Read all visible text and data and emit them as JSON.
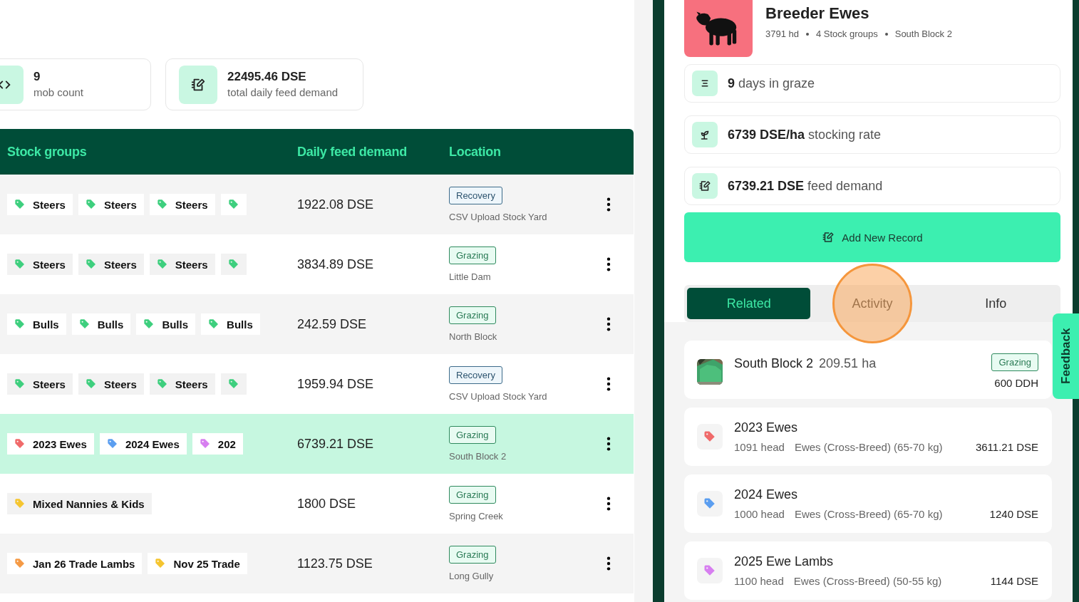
{
  "summary": [
    {
      "kind": "code",
      "value": "9",
      "label": "mob count"
    },
    {
      "kind": "feed",
      "value": "22495.46 DSE",
      "label": "total daily feed demand"
    }
  ],
  "table": {
    "columns": [
      "Stock groups",
      "Daily feed demand",
      "Location"
    ],
    "rows": [
      {
        "selected": false,
        "groups": [
          {
            "label": "Steers",
            "color": "#3ecf7e"
          },
          {
            "label": "Steers",
            "color": "#3ecf7e"
          },
          {
            "label": "Steers",
            "color": "#3ecf7e"
          },
          {
            "color": "#3ecf7e"
          }
        ],
        "demand": "1922.08 DSE",
        "status": {
          "label": "Recovery",
          "kind": "recovery"
        },
        "location": "CSV Upload Stock Yard"
      },
      {
        "selected": false,
        "groups": [
          {
            "label": "Steers",
            "color": "#3ecf7e"
          },
          {
            "label": "Steers",
            "color": "#3ecf7e"
          },
          {
            "label": "Steers",
            "color": "#3ecf7e"
          },
          {
            "color": "#3ecf7e"
          }
        ],
        "demand": "3834.89 DSE",
        "status": {
          "label": "Grazing",
          "kind": "grazing"
        },
        "location": "Little Dam"
      },
      {
        "selected": false,
        "groups": [
          {
            "label": "Bulls",
            "color": "#3ecf7e"
          },
          {
            "label": "Bulls",
            "color": "#3ecf7e"
          },
          {
            "label": "Bulls",
            "color": "#3ecf7e"
          },
          {
            "label": "Bulls",
            "color": "#3ecf7e"
          }
        ],
        "demand": "242.59 DSE",
        "status": {
          "label": "Grazing",
          "kind": "grazing"
        },
        "location": "North Block"
      },
      {
        "selected": false,
        "groups": [
          {
            "label": "Steers",
            "color": "#3ecf7e"
          },
          {
            "label": "Steers",
            "color": "#3ecf7e"
          },
          {
            "label": "Steers",
            "color": "#3ecf7e"
          },
          {
            "color": "#3ecf7e"
          }
        ],
        "demand": "1959.94 DSE",
        "status": {
          "label": "Recovery",
          "kind": "recovery"
        },
        "location": "CSV Upload Stock Yard"
      },
      {
        "selected": true,
        "groups": [
          {
            "label": "2023 Ewes",
            "color": "#f06a6a"
          },
          {
            "label": "2024 Ewes",
            "color": "#5b9ef0"
          },
          {
            "label": "202",
            "color": "#d77ff0"
          }
        ],
        "demand": "6739.21 DSE",
        "status": {
          "label": "Grazing",
          "kind": "grazing"
        },
        "location": "South Block 2"
      },
      {
        "selected": false,
        "groups": [
          {
            "label": "Mixed Nannies & Kids",
            "color": "#f5c530"
          }
        ],
        "demand": "1800 DSE",
        "status": {
          "label": "Grazing",
          "kind": "grazing"
        },
        "location": "Spring Creek"
      },
      {
        "selected": false,
        "groups": [
          {
            "label": "Jan 26 Trade Lambs",
            "color": "#f59a45"
          },
          {
            "label": "Nov 25 Trade",
            "color": "#f5c530"
          }
        ],
        "demand": "1123.75 DSE",
        "status": {
          "label": "Grazing",
          "kind": "grazing"
        },
        "location": "Long Gully"
      }
    ]
  },
  "detail": {
    "title": "Breeder Ewes",
    "meta": [
      "3791 hd",
      "4 Stock groups",
      "South Block 2"
    ],
    "stats": [
      {
        "kind": "days",
        "text": "**9** days in graze"
      },
      {
        "kind": "rate",
        "text": "**6739 DSE/ha** stocking rate"
      },
      {
        "kind": "feed",
        "text": "**6739.21 DSE** feed demand"
      }
    ],
    "action": "Add New Record",
    "tabs": [
      {
        "label": "Related",
        "selected": true,
        "highlighted": false
      },
      {
        "label": "Activity",
        "selected": false,
        "highlighted": true
      },
      {
        "label": "Info",
        "selected": false,
        "highlighted": false
      }
    ],
    "paddock": {
      "name": "South Block 2",
      "area": "209.51 ha",
      "status": {
        "label": "Grazing",
        "kind": "grazing"
      },
      "reading": "600 DDH"
    },
    "groups": [
      {
        "name": "2023 Ewes",
        "head": "1091 head",
        "type": "Ewes (Cross-Breed) (65-70 kg)",
        "demand": "3611.21 DSE",
        "color": "#f06a6a"
      },
      {
        "name": "2024 Ewes",
        "head": "1000 head",
        "type": "Ewes (Cross-Breed) (65-70 kg)",
        "demand": "1240 DSE",
        "color": "#5b9ef0"
      },
      {
        "name": "2025 Ewe Lambs",
        "head": "1100 head",
        "type": "Ewes (Cross-Breed) (50-55 kg)",
        "demand": "1144 DSE",
        "color": "#d77ff0"
      }
    ]
  },
  "feedback": "Feedback"
}
